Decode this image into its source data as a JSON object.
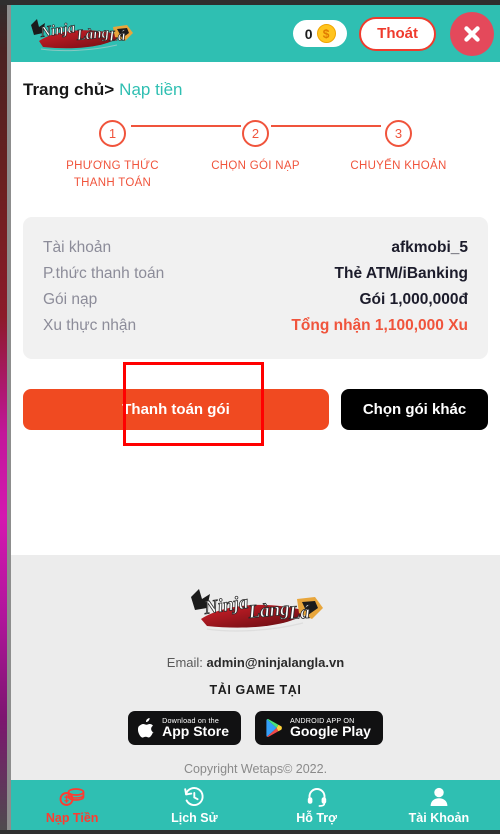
{
  "header": {
    "logo_alt": "Ninja Làng Lá",
    "coin_balance": "0",
    "coin_icon": "gold-coin-dollar-icon",
    "exit_label": "Thoát",
    "close_icon": "close-x-icon"
  },
  "breadcrumb": {
    "home": "Trang chủ",
    "separator": ">",
    "current": "Nạp tiền"
  },
  "stepper": {
    "steps": [
      {
        "number": "1",
        "label": "PHƯƠNG THỨC THANH TOÁN"
      },
      {
        "number": "2",
        "label": "CHỌN GÓI NẠP"
      },
      {
        "number": "3",
        "label": "CHUYỂN KHOẢN"
      }
    ]
  },
  "summary": {
    "rows": [
      {
        "key": "Tài khoản",
        "value": "afkmobi_5"
      },
      {
        "key": "P.thức thanh toán",
        "value": "Thẻ ATM/iBanking"
      },
      {
        "key": "Gói nạp",
        "value": "Gói 1,000,000đ"
      },
      {
        "key": "Xu thực nhận",
        "value": "Tổng nhận 1,100,000 Xu"
      }
    ]
  },
  "actions": {
    "pay_label": "Thanh toán gói",
    "other_label": "Chọn gói khác"
  },
  "footer": {
    "logo_alt": "Ninja Làng Lá",
    "email_prefix": "Email: ",
    "email": "admin@ninjalangla.vn",
    "download_title": "TẢI GAME TẠI",
    "stores": [
      {
        "top": "Download on the",
        "bottom": "App Store",
        "icon": "apple-icon"
      },
      {
        "top": "ANDROID APP ON",
        "bottom": "Google Play",
        "icon": "google-play-icon"
      }
    ],
    "copyright": "Copyright Wetaps© 2022."
  },
  "bottomnav": {
    "items": [
      {
        "label": "Nạp Tiền",
        "icon": "coins-stack-icon",
        "active": true
      },
      {
        "label": "Lịch Sử",
        "icon": "clock-history-icon",
        "active": false
      },
      {
        "label": "Hỗ Trợ",
        "icon": "headset-support-icon",
        "active": false
      },
      {
        "label": "Tài Khoản",
        "icon": "user-account-icon",
        "active": false
      }
    ]
  },
  "colors": {
    "teal": "#2fbfb2",
    "accent_orange": "#f0543c",
    "pay_button": "#f04a21",
    "annotation_red": "#ff0000",
    "footer_bg": "#ececec"
  }
}
